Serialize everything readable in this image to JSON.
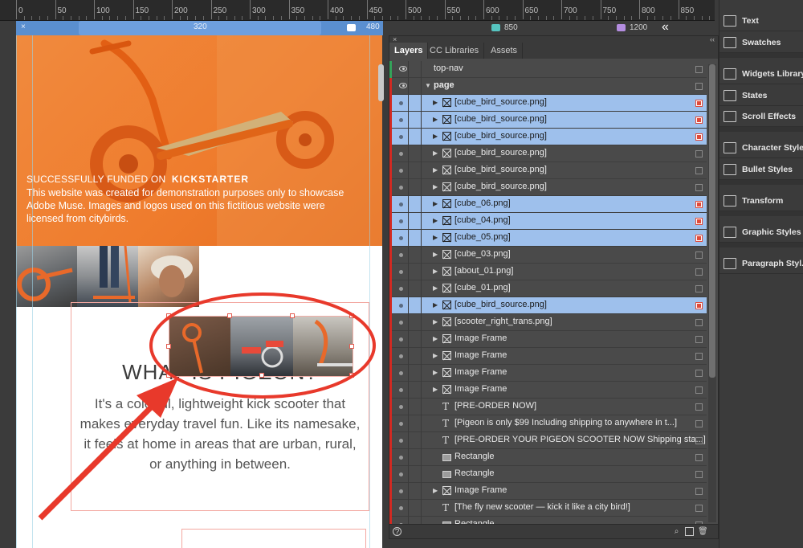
{
  "ruler": {
    "ticks": [
      "0",
      "50",
      "100",
      "150",
      "200",
      "250",
      "300",
      "350",
      "400",
      "450",
      "500",
      "550",
      "600",
      "650",
      "700",
      "750",
      "800",
      "850"
    ]
  },
  "breakpoints": {
    "close": "×",
    "width_label": "320",
    "bp480": "480",
    "bp850": "850",
    "bp1200": "1200",
    "chevrons": "«"
  },
  "canvas": {
    "hero_title": "SUCCESSFULLY FUNDED ON",
    "hero_brand": "KICKSTARTER",
    "hero_body": "This website was created for demonstration purposes only to showcase Adobe Muse. Images and logos used on this fictitious website were licensed from citybirds.",
    "what_title": "WHAT IS PIGEON?",
    "what_body": "It's a colorful, lightweight kick scooter that makes everyday travel fun. Like its namesake, it feels at home in areas that are urban, rural, or anything in between."
  },
  "layers_panel": {
    "tabs": [
      "Layers",
      "CC Libraries",
      "Assets"
    ],
    "close": "×",
    "collapse": "‹‹",
    "rows": [
      {
        "label": "top-nav",
        "type": "layer",
        "selected": false
      },
      {
        "label": "page",
        "type": "layer",
        "selected": false
      },
      {
        "label": "[cube_bird_source.png]",
        "type": "frame",
        "selected": true
      },
      {
        "label": "[cube_bird_source.png]",
        "type": "frame",
        "selected": true
      },
      {
        "label": "[cube_bird_source.png]",
        "type": "frame",
        "selected": true
      },
      {
        "label": "[cube_bird_source.png]",
        "type": "frame",
        "selected": false
      },
      {
        "label": "[cube_bird_source.png]",
        "type": "frame",
        "selected": false
      },
      {
        "label": "[cube_bird_source.png]",
        "type": "frame",
        "selected": false
      },
      {
        "label": "[cube_06.png]",
        "type": "frame",
        "selected": true
      },
      {
        "label": "[cube_04.png]",
        "type": "frame",
        "selected": true
      },
      {
        "label": "[cube_05.png]",
        "type": "frame",
        "selected": true
      },
      {
        "label": "[cube_03.png]",
        "type": "frame",
        "selected": false
      },
      {
        "label": "[about_01.png]",
        "type": "frame",
        "selected": false
      },
      {
        "label": "[cube_01.png]",
        "type": "frame",
        "selected": false
      },
      {
        "label": "[cube_bird_source.png]",
        "type": "frame",
        "selected": true
      },
      {
        "label": "[scooter_right_trans.png]",
        "type": "frame",
        "selected": false
      },
      {
        "label": "Image Frame",
        "type": "frame",
        "selected": false
      },
      {
        "label": "Image Frame",
        "type": "frame",
        "selected": false
      },
      {
        "label": "Image Frame",
        "type": "frame",
        "selected": false
      },
      {
        "label": "Image Frame",
        "type": "frame",
        "selected": false
      },
      {
        "label": "[PRE-ORDER NOW]",
        "type": "text",
        "selected": false
      },
      {
        "label": "[Pigeon is only $99 Including shipping to anywhere in t...]",
        "type": "text",
        "selected": false
      },
      {
        "label": "[PRE-ORDER YOUR PIGEON SCOOTER NOW Shipping sta...]",
        "type": "text",
        "selected": false
      },
      {
        "label": "Rectangle",
        "type": "rect",
        "selected": false
      },
      {
        "label": "Rectangle",
        "type": "rect",
        "selected": false
      },
      {
        "label": "Image Frame",
        "type": "frame",
        "selected": false
      },
      {
        "label": "[The fly new scooter — kick it like a city bird!]",
        "type": "text",
        "selected": false
      },
      {
        "label": "Rectangle",
        "type": "rect",
        "selected": false
      }
    ],
    "footer_icons": [
      "help-icon",
      "search-icon",
      "new-layer-icon",
      "trash-icon"
    ]
  },
  "dock": {
    "items": [
      {
        "label": "Text",
        "icon": "text-icon"
      },
      {
        "label": "Swatches",
        "icon": "swatches-icon"
      },
      {
        "label": "Widgets Library",
        "icon": "widgets-icon"
      },
      {
        "label": "States",
        "icon": "states-icon"
      },
      {
        "label": "Scroll Effects",
        "icon": "scroll-effects-icon"
      },
      {
        "label": "Character Styles",
        "icon": "character-styles-icon"
      },
      {
        "label": "Bullet Styles",
        "icon": "bullet-styles-icon"
      },
      {
        "label": "Transform",
        "icon": "transform-icon"
      },
      {
        "label": "Graphic Styles",
        "icon": "graphic-styles-icon"
      },
      {
        "label": "Paragraph Styl...",
        "icon": "paragraph-styles-icon"
      }
    ]
  },
  "colors": {
    "hero_orange": "#ef7c2d",
    "selection_blue": "#9ec0ec",
    "annotation_red": "#e8392b",
    "breakpoint_blue": "#5a8fd0"
  }
}
